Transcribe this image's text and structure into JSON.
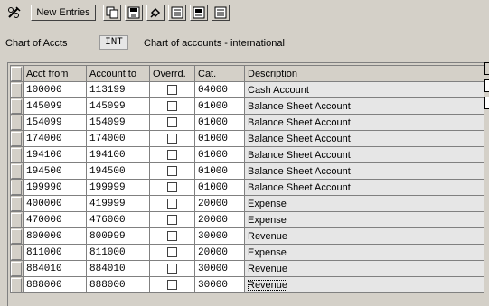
{
  "toolbar": {
    "new_entries_label": "New Entries",
    "icons": [
      "glasses-pencil-icon",
      "copy-icon",
      "save-icon",
      "undo-icon",
      "select-all-icon",
      "select-block-icon",
      "deselect-icon"
    ]
  },
  "header": {
    "chart_label": "Chart of Accts",
    "chart_value": "INT",
    "chart_description": "Chart of accounts - international"
  },
  "table": {
    "columns": [
      "Acct from",
      "Account to",
      "Overrd.",
      "Cat.",
      "Description"
    ],
    "rows": [
      {
        "from": "100000",
        "to": "113199",
        "override": false,
        "cat": "04000",
        "desc": "Cash Account"
      },
      {
        "from": "145099",
        "to": "145099",
        "override": false,
        "cat": "01000",
        "desc": "Balance Sheet Account"
      },
      {
        "from": "154099",
        "to": "154099",
        "override": false,
        "cat": "01000",
        "desc": "Balance Sheet Account"
      },
      {
        "from": "174000",
        "to": "174000",
        "override": false,
        "cat": "01000",
        "desc": "Balance Sheet Account"
      },
      {
        "from": "194100",
        "to": "194100",
        "override": false,
        "cat": "01000",
        "desc": "Balance Sheet Account"
      },
      {
        "from": "194500",
        "to": "194500",
        "override": false,
        "cat": "01000",
        "desc": "Balance Sheet Account"
      },
      {
        "from": "199990",
        "to": "199999",
        "override": false,
        "cat": "01000",
        "desc": "Balance Sheet Account"
      },
      {
        "from": "400000",
        "to": "419999",
        "override": false,
        "cat": "20000",
        "desc": "Expense"
      },
      {
        "from": "470000",
        "to": "476000",
        "override": false,
        "cat": "20000",
        "desc": "Expense"
      },
      {
        "from": "800000",
        "to": "800999",
        "override": false,
        "cat": "30000",
        "desc": "Revenue"
      },
      {
        "from": "811000",
        "to": "811000",
        "override": false,
        "cat": "20000",
        "desc": "Expense"
      },
      {
        "from": "884010",
        "to": "884010",
        "override": false,
        "cat": "30000",
        "desc": "Revenue"
      },
      {
        "from": "888000",
        "to": "888000",
        "override": false,
        "cat": "30000",
        "desc": "Revenue"
      }
    ]
  }
}
